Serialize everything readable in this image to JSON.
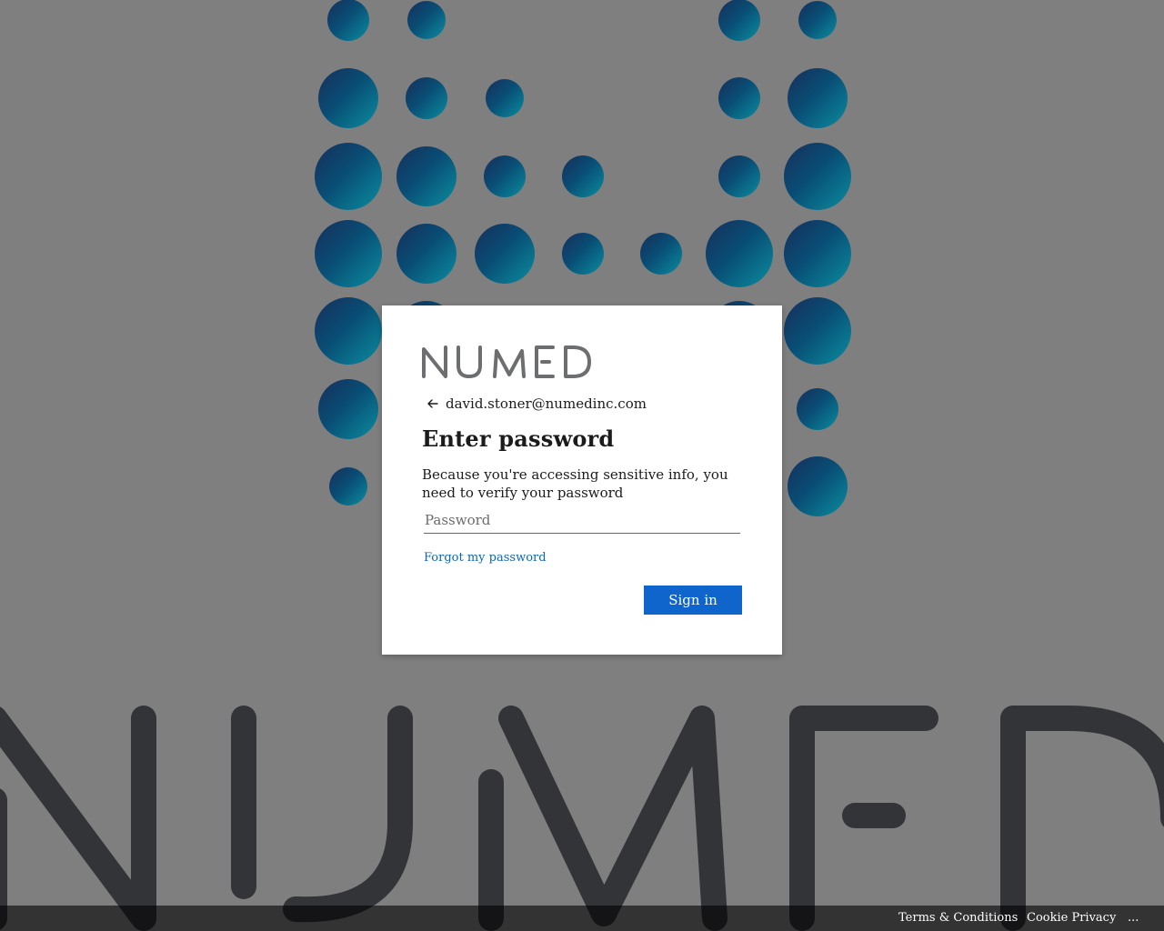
{
  "brand": {
    "logo_text": "NUMED",
    "dot_color_start": "#17335e",
    "dot_color_end": "#0a8ea0",
    "watermark_text": "NUMED",
    "watermark_color": "#333437"
  },
  "login": {
    "email": "david.stoner@numedinc.com",
    "title": "Enter password",
    "description": "Because you're accessing sensitive info, you need to verify your password",
    "password_placeholder": "Password",
    "password_value": "",
    "forgot_label": "Forgot my password",
    "signin_label": "Sign in",
    "accent_color": "#0f65cc"
  },
  "footer": {
    "terms_label": "Terms & Conditions",
    "privacy_label": "Cookie Privacy",
    "more_label": "..."
  },
  "icons": {
    "back": "arrow-left-icon"
  }
}
